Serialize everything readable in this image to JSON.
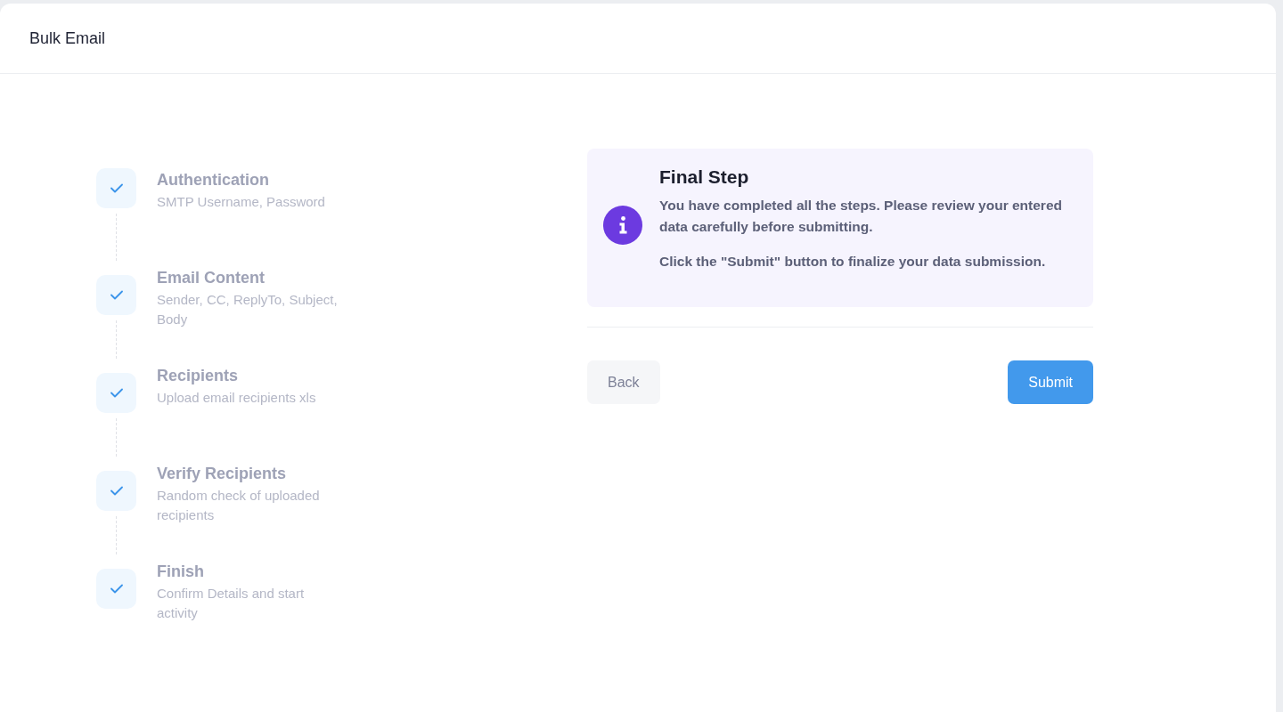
{
  "header": {
    "title": "Bulk Email"
  },
  "steps": [
    {
      "title": "Authentication",
      "description": "SMTP Username, Password",
      "completed": true
    },
    {
      "title": "Email Content",
      "description": "Sender, CC, ReplyTo, Subject, Body",
      "completed": true
    },
    {
      "title": "Recipients",
      "description": "Upload email recipients xls",
      "completed": true
    },
    {
      "title": "Verify Recipients",
      "description": "Random check of uploaded recipients",
      "completed": true
    },
    {
      "title": "Finish",
      "description": "Confirm Details and start activity",
      "completed": true
    }
  ],
  "notice": {
    "title": "Final Step",
    "paragraphs": [
      "You have completed all the steps. Please review your entered data carefully before submitting.",
      "Click the \"Submit\" button to finalize your data submission."
    ]
  },
  "buttons": [
    {
      "label": "Back",
      "kind": "secondary"
    },
    {
      "label": "Submit",
      "kind": "primary"
    }
  ]
}
